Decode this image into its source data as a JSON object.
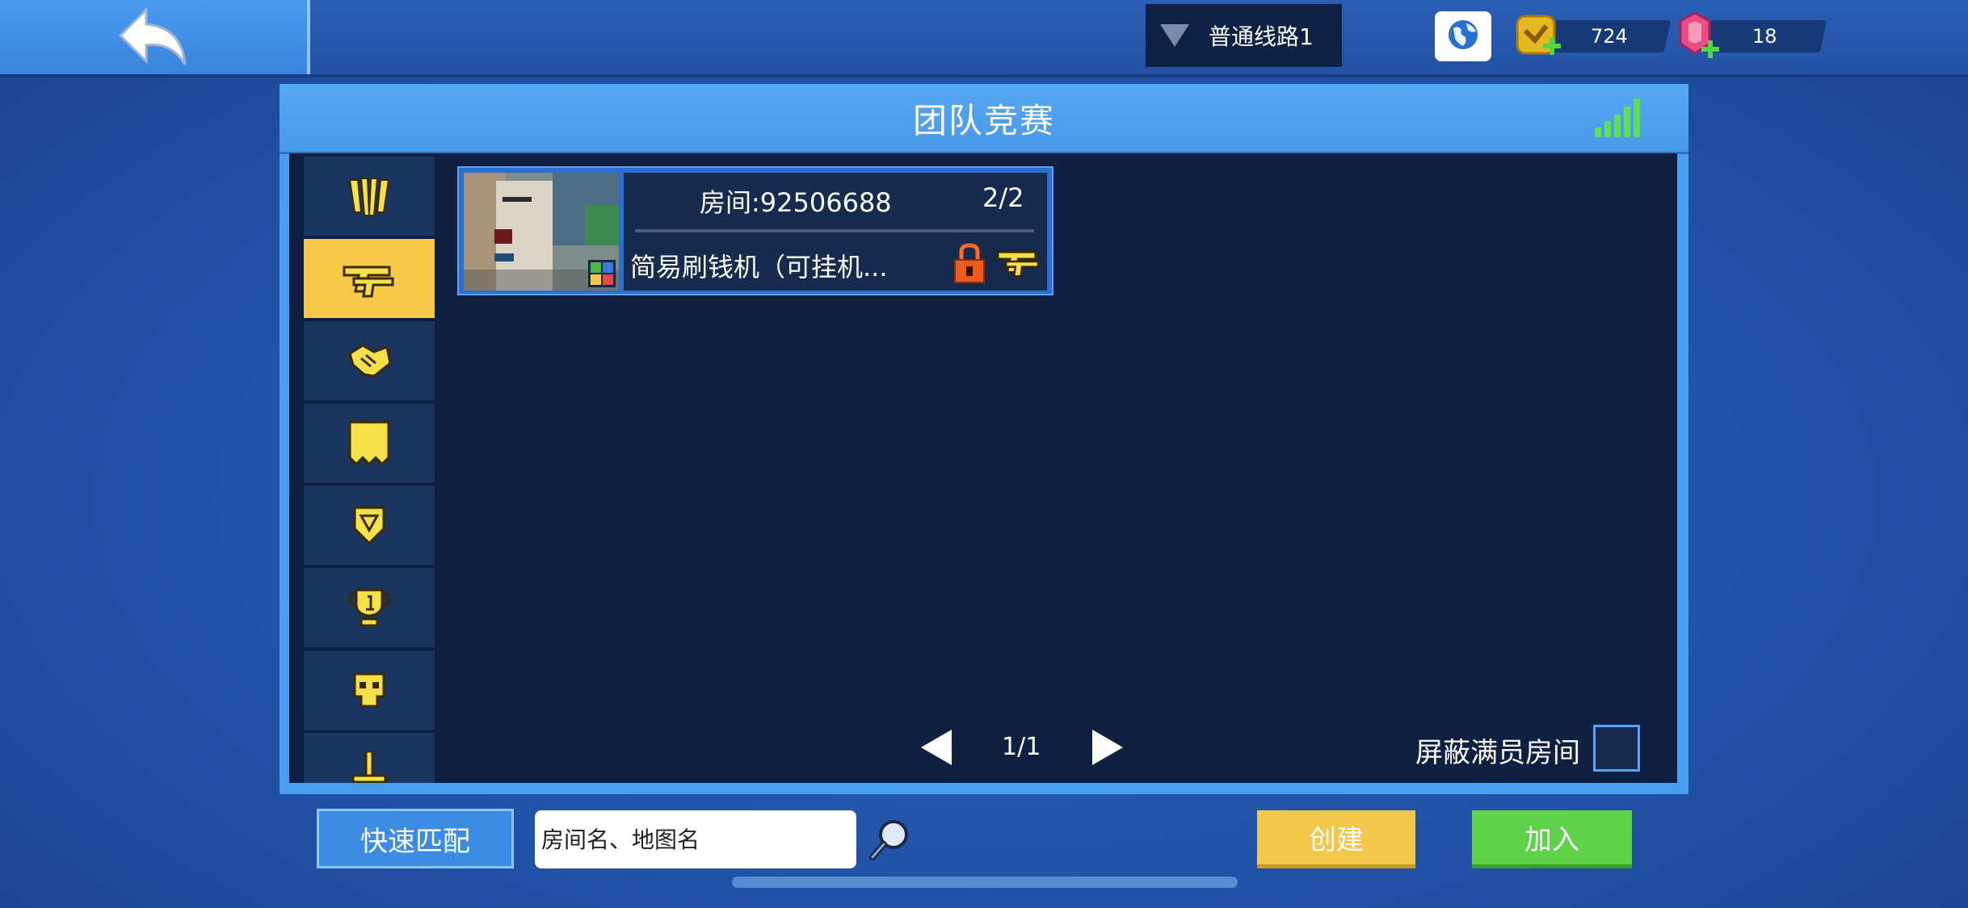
{
  "top_bar": {
    "line_selector_label": "普通线路1",
    "coins": "724",
    "gems": "18"
  },
  "panel": {
    "title": "团队竞赛"
  },
  "sidebar": {
    "items": [
      {
        "icon": "claw-icon"
      },
      {
        "icon": "pistol-icon",
        "active": true
      },
      {
        "icon": "handshake-icon"
      },
      {
        "icon": "flag-icon"
      },
      {
        "icon": "shield-badge-icon"
      },
      {
        "icon": "trophy-icon"
      },
      {
        "icon": "skull-icon"
      },
      {
        "icon": "sword-icon"
      }
    ]
  },
  "rooms": [
    {
      "id_label": "房间:92506688",
      "count": "2/2",
      "name": "简易刷钱机（可挂机..."
    }
  ],
  "pager": {
    "label": "1/1"
  },
  "filter": {
    "hide_full_label": "屏蔽满员房间",
    "hide_full_checked": false
  },
  "bottom": {
    "quick_match_label": "快速匹配",
    "search_placeholder": "房间名、地图名",
    "create_label": "创建",
    "join_label": "加入"
  },
  "colors": {
    "accent_blue": "#4a9ef0",
    "active_tab": "#f5c945",
    "create": "#f3c74a",
    "join": "#5fd24a"
  }
}
